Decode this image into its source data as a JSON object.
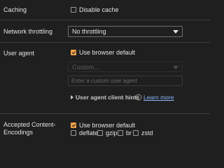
{
  "caching": {
    "label": "Caching",
    "disable_cache_label": "Disable cache",
    "disable_cache_checked": false
  },
  "network_throttling": {
    "label": "Network throttling",
    "selected": "No throttling"
  },
  "user_agent": {
    "label": "User agent",
    "use_browser_default_label": "Use browser default",
    "use_browser_default_checked": true,
    "custom_select_value": "Custom...",
    "custom_input_placeholder": "Enter a custom user agent",
    "client_hints_label": "User agent client hints",
    "learn_more_label": "Learn more"
  },
  "accepted_encodings": {
    "label_line1": "Accepted Content-",
    "label_line2": "Encodings",
    "use_browser_default_label": "Use browser default",
    "use_browser_default_checked": true,
    "options": [
      {
        "label": "deflate",
        "checked": false
      },
      {
        "label": "gzip",
        "checked": false
      },
      {
        "label": "br",
        "checked": false
      },
      {
        "label": "zstd",
        "checked": false
      }
    ]
  },
  "colors": {
    "background": "#1f1f1f",
    "accent": "#f0a04b",
    "link": "#8ab4f8",
    "divider": "#3c3c3c"
  }
}
